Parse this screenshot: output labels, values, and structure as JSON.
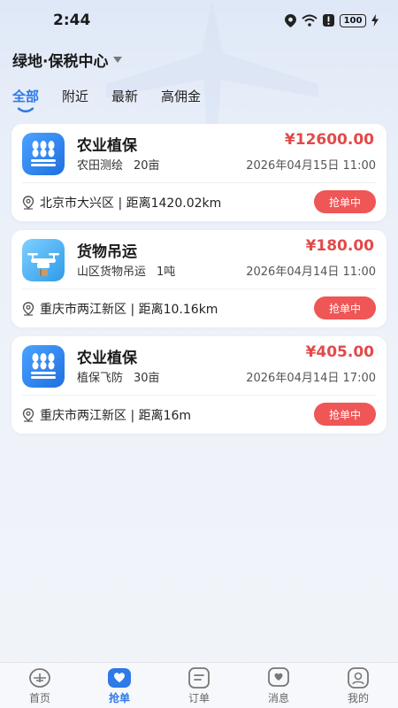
{
  "status_bar": {
    "time": "2:44",
    "battery": "100"
  },
  "header": {
    "location": "绿地·保税中心"
  },
  "tabs": [
    {
      "label": "全部",
      "active": true
    },
    {
      "label": "附近",
      "active": false
    },
    {
      "label": "最新",
      "active": false
    },
    {
      "label": "高佣金",
      "active": false
    }
  ],
  "orders": [
    {
      "title": "农业植保",
      "service": "农田测绘",
      "quantity": "20亩",
      "price": "¥12600.00",
      "time": "2026年04月15日 11:00",
      "address": "北京市大兴区 | 距离1420.02km",
      "action": "抢单中",
      "icon": "crop-icon"
    },
    {
      "title": "货物吊运",
      "service": "山区货物吊运",
      "quantity": "1吨",
      "price": "¥180.00",
      "time": "2026年04月14日 11:00",
      "address": "重庆市两江新区 | 距离10.16km",
      "action": "抢单中",
      "icon": "drone-icon"
    },
    {
      "title": "农业植保",
      "service": "植保飞防",
      "quantity": "30亩",
      "price": "¥405.00",
      "time": "2026年04月14日 17:00",
      "address": "重庆市两江新区 | 距离16m",
      "action": "抢单中",
      "icon": "crop-icon"
    }
  ],
  "bottom_nav": [
    {
      "label": "首页",
      "icon": "home-icon",
      "active": false
    },
    {
      "label": "抢单",
      "icon": "grab-order-icon",
      "active": true
    },
    {
      "label": "订单",
      "icon": "order-icon",
      "active": false
    },
    {
      "label": "消息",
      "icon": "message-icon",
      "active": false
    },
    {
      "label": "我的",
      "icon": "profile-icon",
      "active": false
    }
  ],
  "colors": {
    "accent": "#2e7ae8",
    "price": "#e24a4a",
    "grab_button": "#ef5656"
  }
}
